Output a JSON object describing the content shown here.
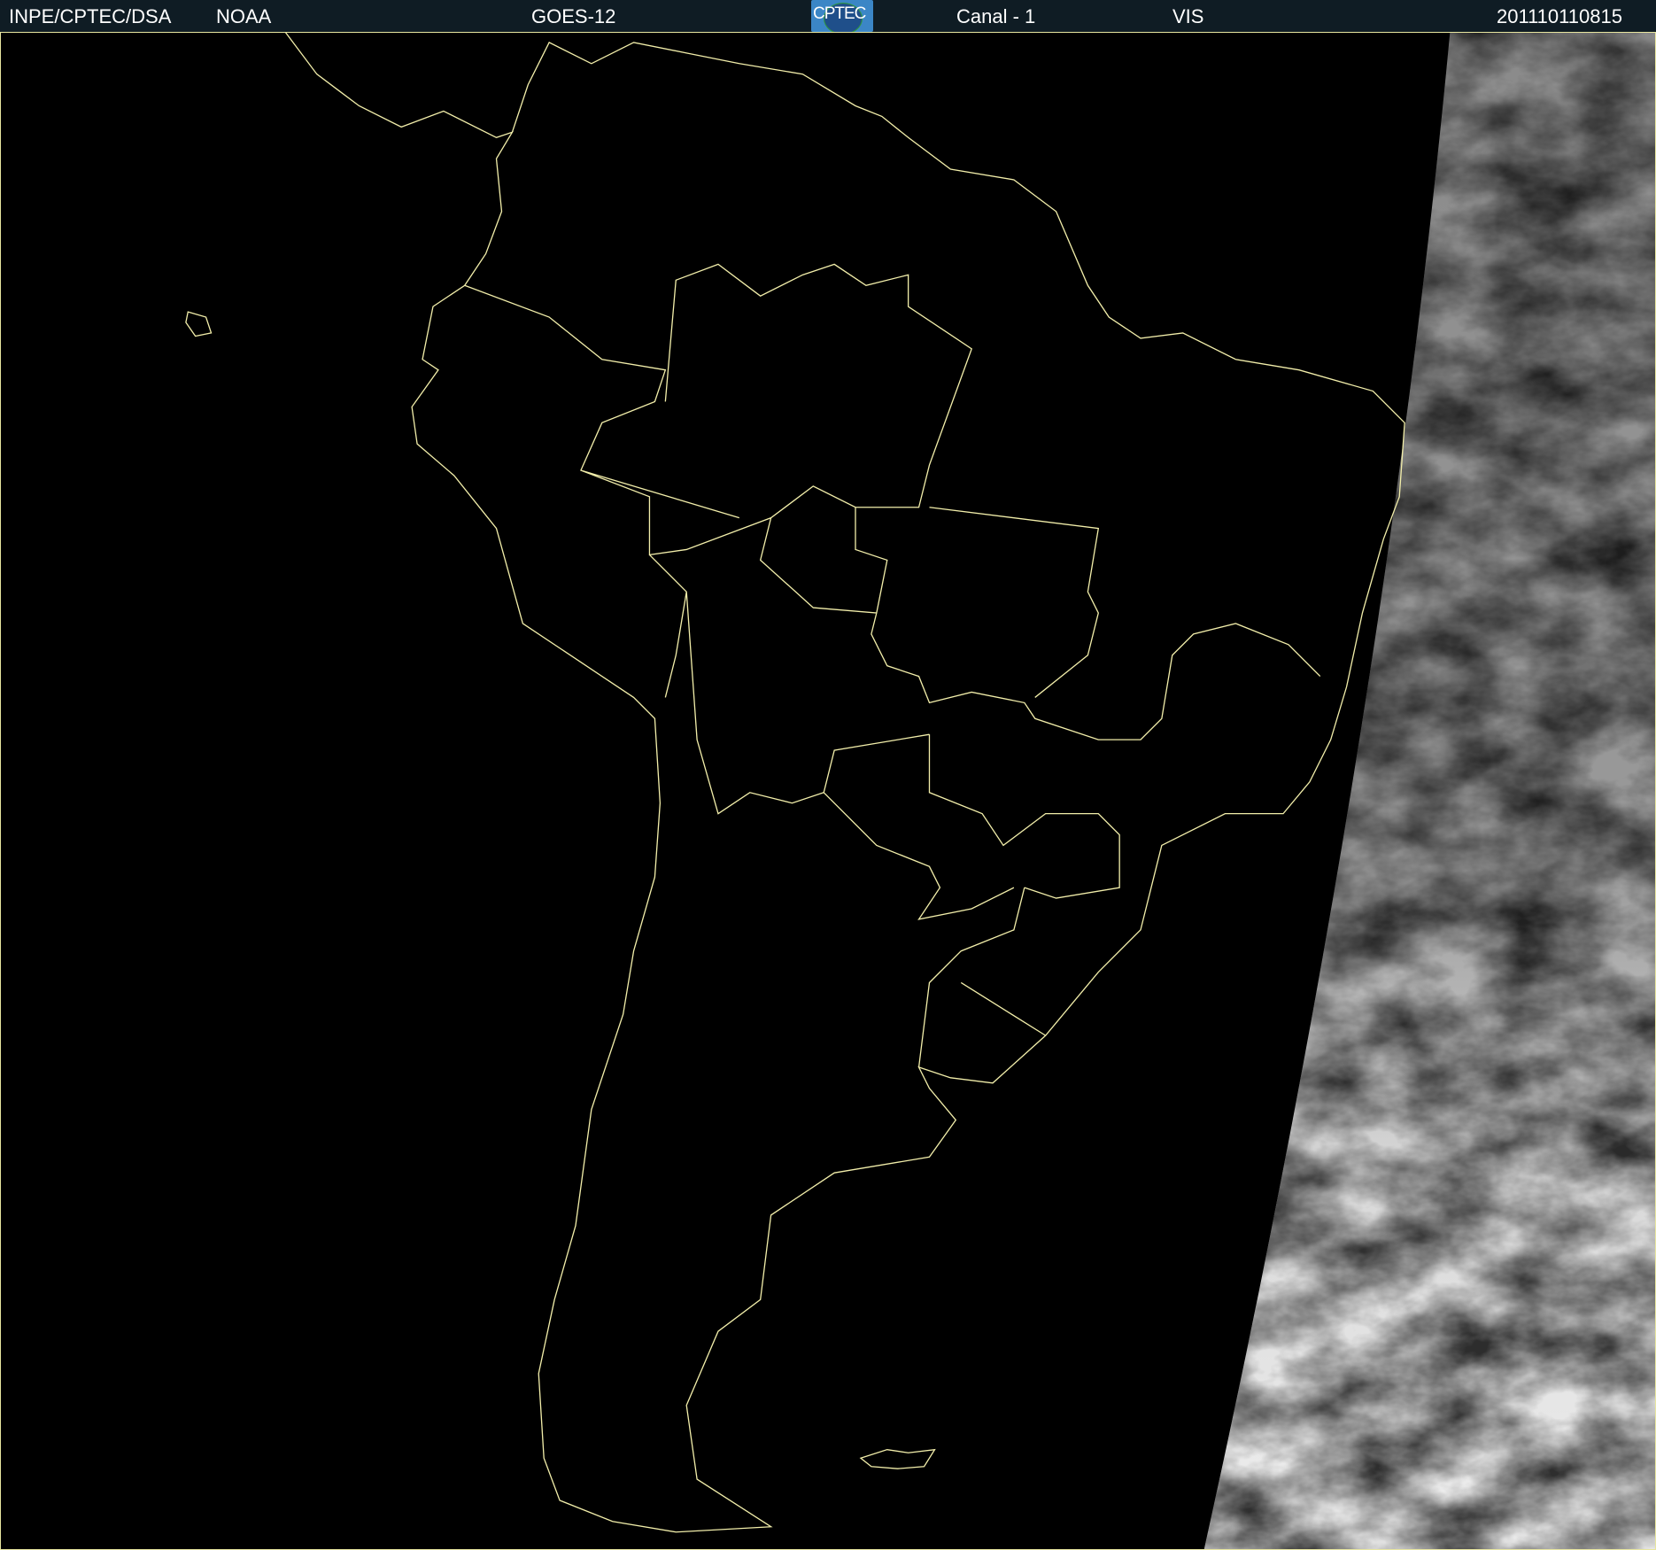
{
  "header": {
    "institution": "INPE/CPTEC/DSA",
    "agency": "NOAA",
    "satellite": "GOES-12",
    "logo_text": "CPTEC",
    "channel": "Canal - 1",
    "band": "VIS",
    "timestamp": "201110110815"
  },
  "colors": {
    "header_bg": "#0f1c24",
    "outline": "#f2eeaa",
    "background": "#000000"
  }
}
